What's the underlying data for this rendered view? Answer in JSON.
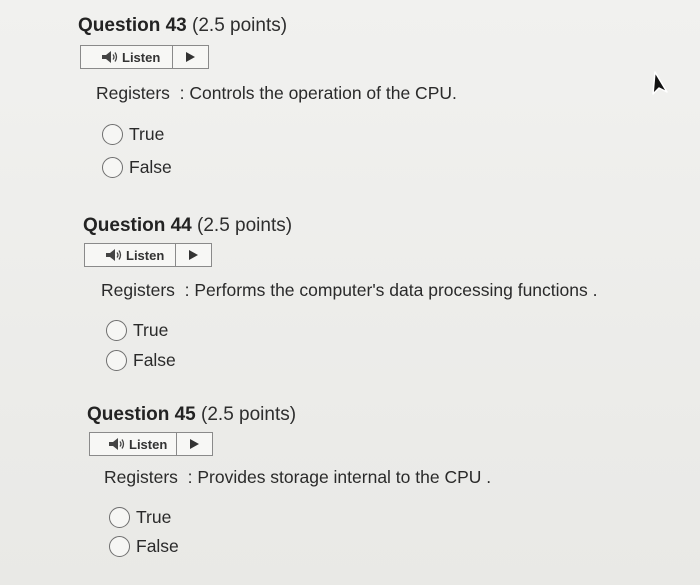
{
  "questions": [
    {
      "label": "Question 43",
      "points": "(2.5 points)",
      "listen_label": "Listen",
      "prompt": "Registers  : Controls the operation of the CPU.",
      "options": [
        "True",
        "False"
      ]
    },
    {
      "label": "Question 44",
      "points": "(2.5 points)",
      "listen_label": "Listen",
      "prompt": "Registers  : Performs the computer's data processing functions .",
      "options": [
        "True",
        "False"
      ]
    },
    {
      "label": "Question 45",
      "points": "(2.5 points)",
      "listen_label": "Listen",
      "prompt": "Registers  : Provides storage internal to the CPU .",
      "options": [
        "True",
        "False"
      ]
    }
  ],
  "icons": {
    "speaker": "speaker-icon",
    "play": "play-icon",
    "cursor": "mouse-cursor-icon"
  }
}
